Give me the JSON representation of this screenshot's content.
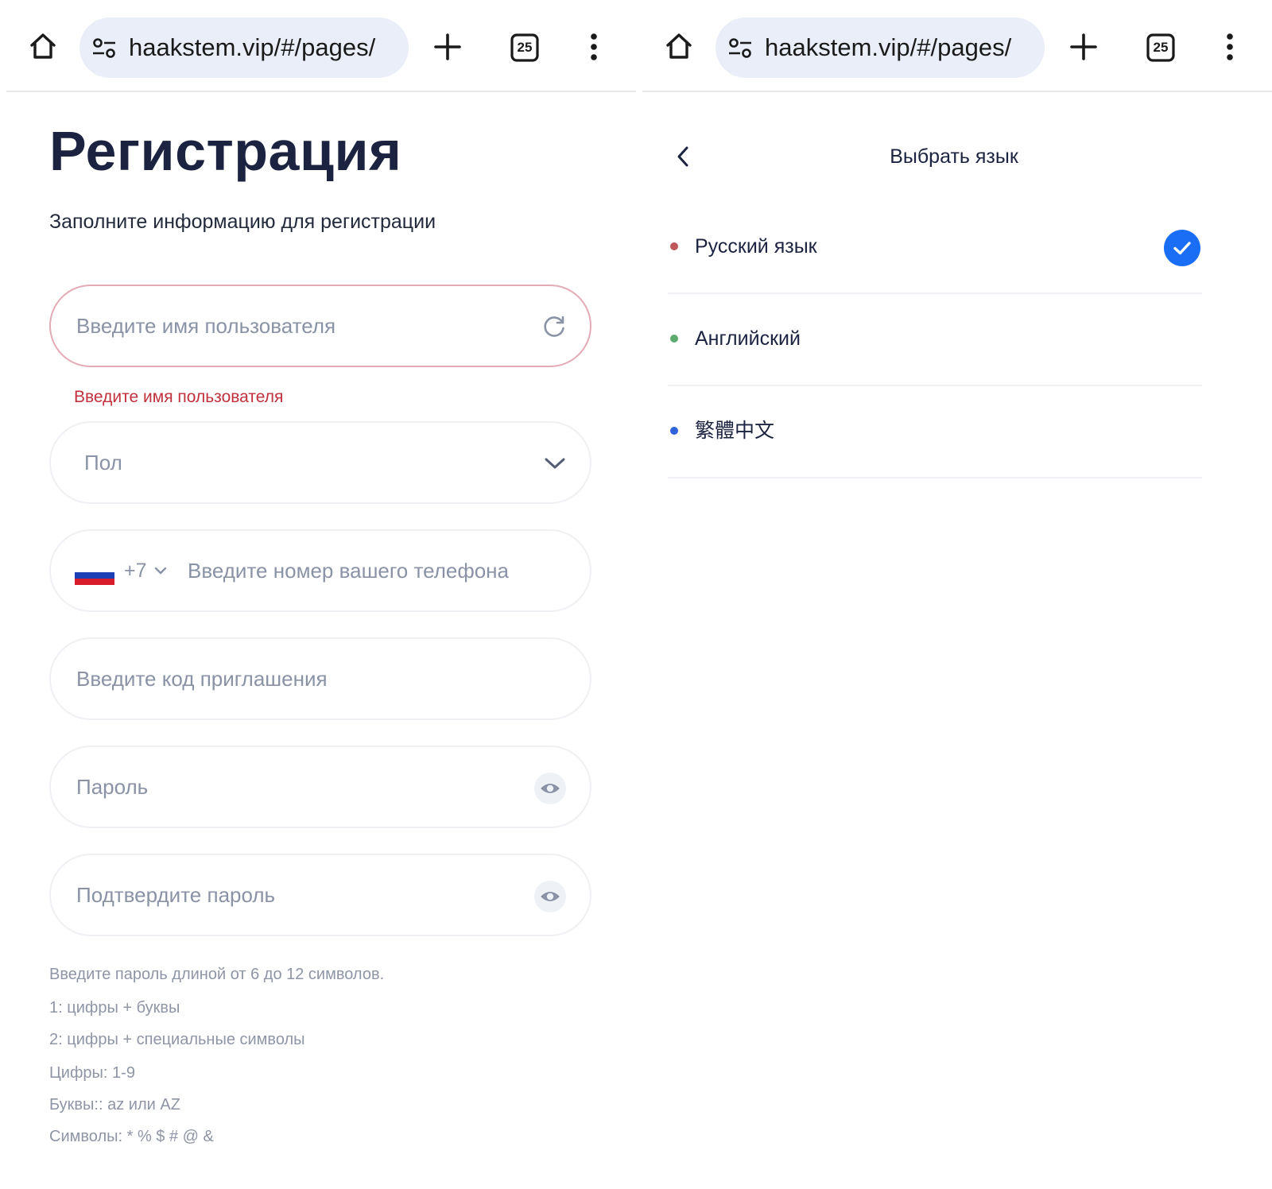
{
  "browser": {
    "url": "haakstem.vip/#/pages/",
    "tab_count": "25"
  },
  "register": {
    "title": "Регистрация",
    "subtitle": "Заполните информацию для регистрации",
    "username_placeholder": "Введите имя пользователя",
    "username_error": "Введите имя пользователя",
    "gender_placeholder": "Пол",
    "phone_code": "+7",
    "phone_placeholder": "Введите номер вашего телефона",
    "invite_placeholder": "Введите код приглашения",
    "password_placeholder": "Пароль",
    "confirm_placeholder": "Подтвердите пароль",
    "hints": [
      "Введите пароль длиной от 6 до 12 символов.",
      "1: цифры + буквы",
      "2: цифры + специальные символы",
      "Цифры: 1-9",
      "Буквы:: az или AZ",
      "Символы: * % $ # @ &"
    ],
    "icons": {
      "username": "refresh-icon",
      "gender": "chevron-down-icon",
      "phone_flag": "russia-flag-icon",
      "password": "eye-icon",
      "confirm": "eye-icon"
    }
  },
  "language": {
    "title": "Выбрать язык",
    "selected_index": 0,
    "items": [
      {
        "label": "Русский язык",
        "dot_color": "#c0575c"
      },
      {
        "label": "Английский",
        "dot_color": "#5aaa6b"
      },
      {
        "label": "繁體中文",
        "dot_color": "#2f62d8"
      }
    ],
    "accent_color": "#1a6ef5"
  },
  "colors": {
    "error": "#c0303d",
    "error_border": "#e4abb6",
    "title": "#1b2340",
    "placeholder": "#8a93a6"
  }
}
